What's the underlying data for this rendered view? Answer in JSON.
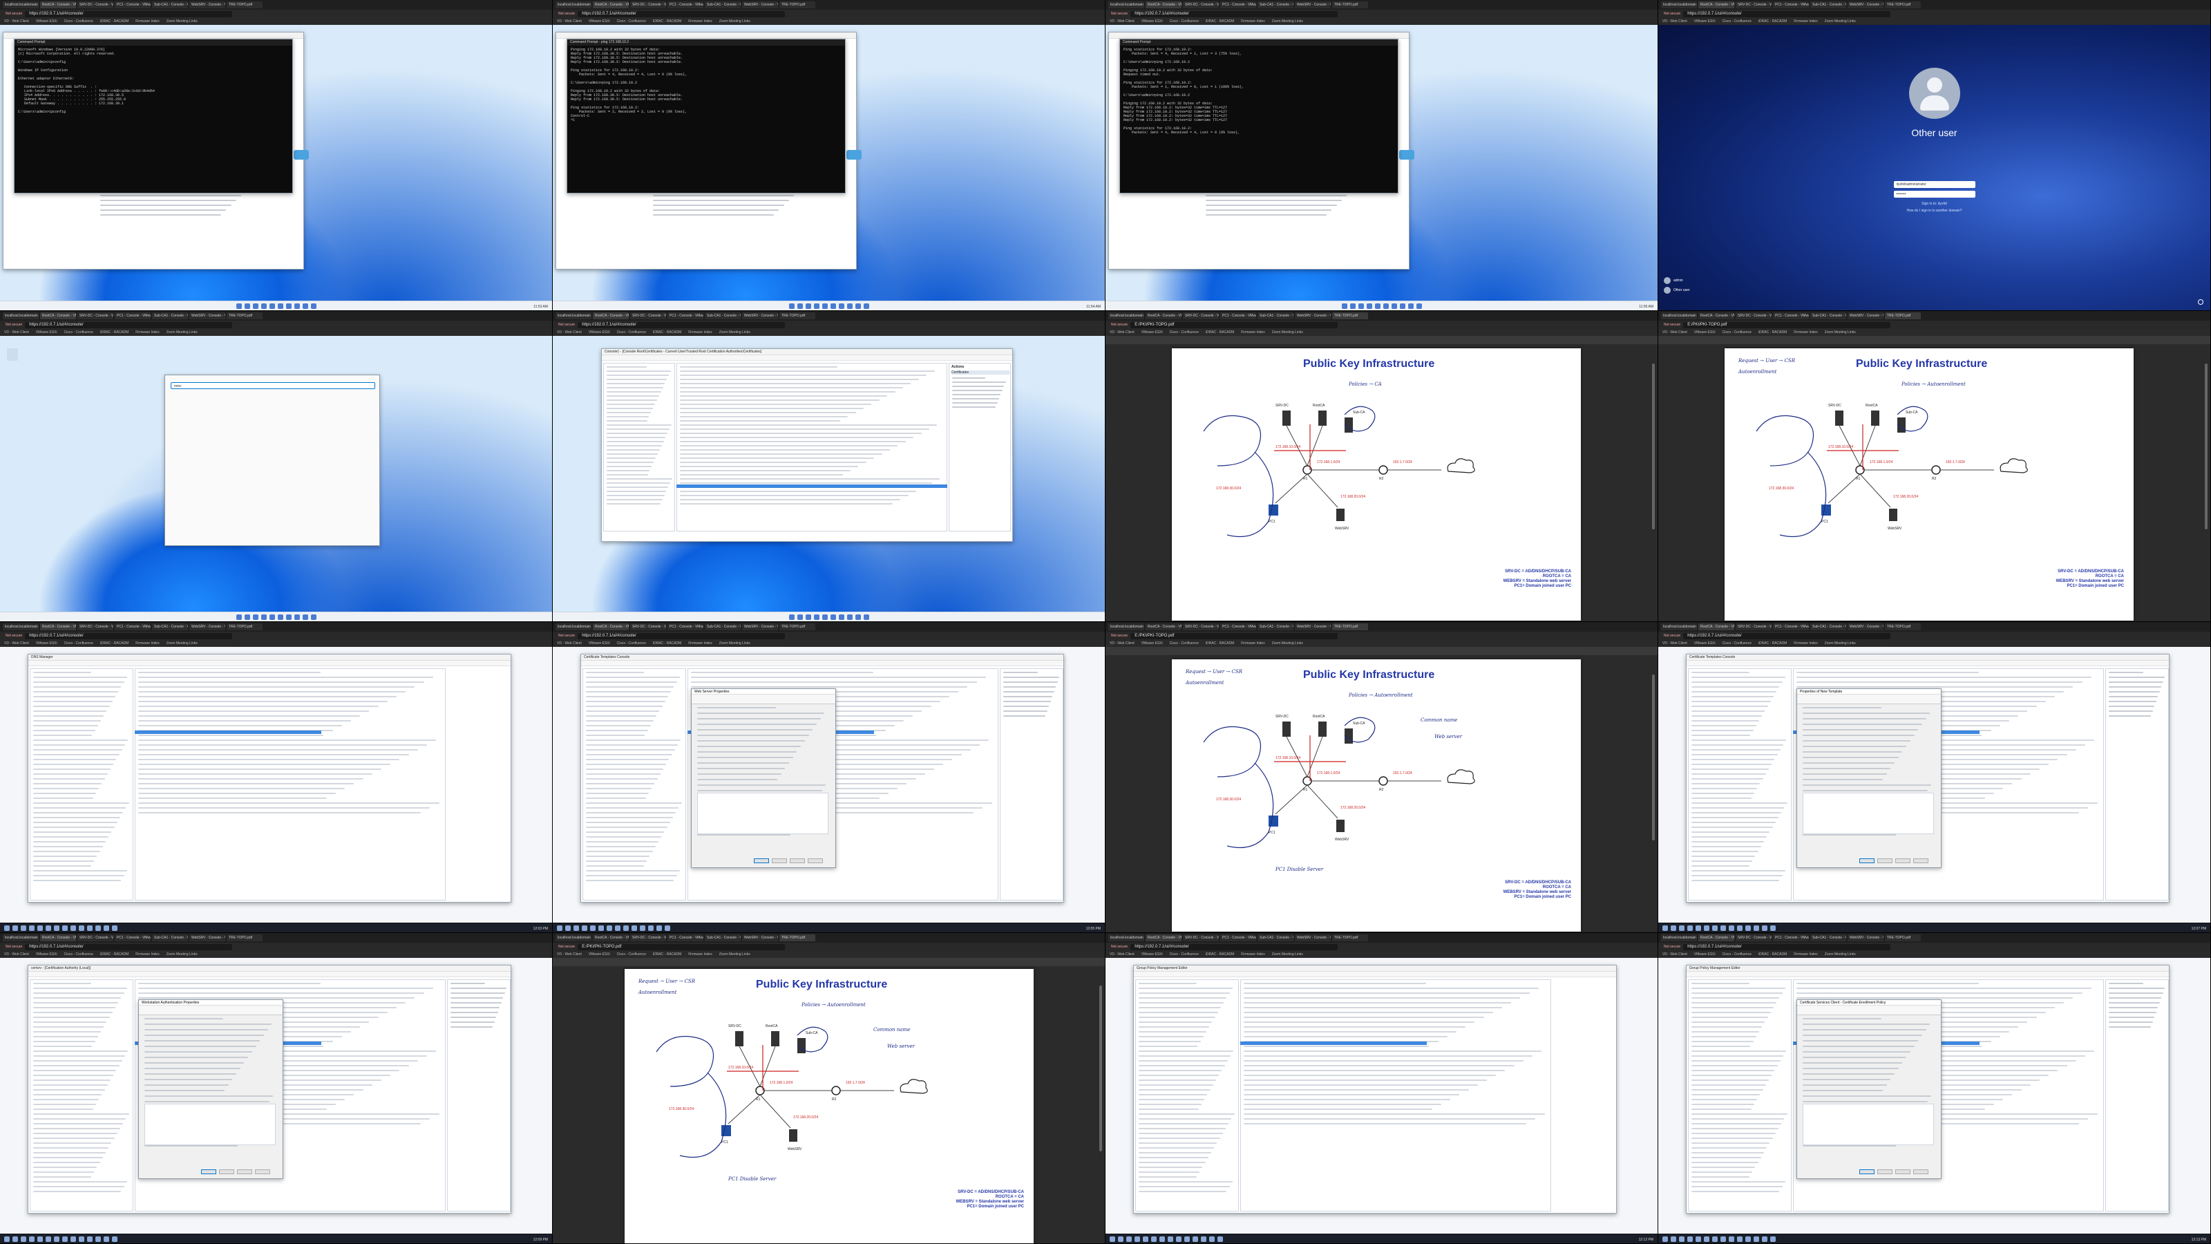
{
  "host": {
    "tab_labels": [
      "localhost.localdomain - VMware",
      "RootCA - Console - VMware ESXi",
      "SRV-DC - Console - VMware ESXi",
      "PC1 - Console - VMware ESXi",
      "Sub-CA1 - Console - VMware ESXi",
      "WebSRV - Console - VMware ESXi",
      "TRE-TOPO.pdf"
    ],
    "active_tab": "Not secure",
    "url_vmware": "https://192.0.7.1/ui/#/console/",
    "url_pdf": "E:/PKI/PKI-TOPO.pdf",
    "bookmarks": [
      "VD - Web Client",
      "VMware ESXi",
      "Cisco - Confluence",
      "iDRAC - RACADM",
      "Firmware Index",
      "Zoom Meeting Links"
    ]
  },
  "tiles": {
    "t1": {
      "kind": "cmd",
      "window_title": "Command Prompt",
      "console_text": "Microsoft Windows [Version 10.0.22000.376]\n(c) Microsoft Corporation. All rights reserved.\n\nC:\\Users\\admin>ipconfig\n\nWindows IP Configuration\n\nEthernet adapter Ethernet0:\n\n   Connection-specific DNS Suffix  . :\n   Link-local IPv6 Address . . . . . : fe80::c4d8:a28e:2c6d:9b4d%4\n   IPv4 Address. . . . . . . . . . . : 172.168.30.5\n   Subnet Mask . . . . . . . . . . . : 255.255.255.0\n   Default Gateway . . . . . . . . . : 172.168.30.1\n\nC:\\Users\\admin>ipconfig",
      "clock": "11:53 AM"
    },
    "t2": {
      "kind": "cmd",
      "window_title": "Command Prompt - ping  172.168.10.2",
      "console_text": "Pinging 172.168.10.2 with 32 bytes of data:\nReply from 172.168.30.5: Destination host unreachable.\nReply from 172.168.30.5: Destination host unreachable.\nReply from 172.168.30.5: Destination host unreachable.\n\nPing statistics for 172.168.10.2:\n    Packets: Sent = 4, Received = 4, Lost = 0 (0% loss),\n\nC:\\Users\\admin>ping 172.168.10.2\n\nPinging 172.168.10.2 with 32 bytes of data:\nReply from 172.168.30.5: Destination host unreachable.\nReply from 172.168.30.5: Destination host unreachable.\n\nPing statistics for 172.168.10.2:\n    Packets: Sent = 2, Received = 2, Lost = 0 (0% loss),\nControl-C\n^C",
      "clock": "11:54 AM"
    },
    "t3": {
      "kind": "cmd",
      "window_title": "Command Prompt",
      "console_text": "Ping statistics for 172.168.10.2:\n    Packets: Sent = 4, Received = 1, Lost = 3 (75% loss),\n\nC:\\Users\\admin>ping 172.168.10.2\n\nPinging 172.168.10.2 with 32 bytes of data:\nRequest timed out.\n\nPing statistics for 172.168.10.2:\n    Packets: Sent = 1, Received = 0, Lost = 1 (100% loss),\n\nC:\\Users\\admin>ping 172.168.10.2\n\nPinging 172.168.10.2 with 32 bytes of data:\nReply from 172.168.10.2: bytes=32 time=1ms TTL=127\nReply from 172.168.10.2: bytes=32 time<1ms TTL=127\nReply from 172.168.10.2: bytes=32 time<1ms TTL=127\nReply from 172.168.10.2: bytes=32 time<1ms TTL=127\n\nPing statistics for 172.168.10.2:\n    Packets: Sent = 4, Received = 4, Lost = 0 (0% loss),",
      "clock": "11:55 AM"
    },
    "t4": {
      "kind": "lock",
      "user_name": "Other user",
      "username_value": "ityoltd\\administrator",
      "password_value": "••••••••",
      "link_domain": "Sign in to: ityoltd",
      "link_other": "How do I sign in to another domain?",
      "accounts": [
        "admin",
        "Other user"
      ]
    },
    "t5": {
      "kind": "run",
      "run_value": "mmc"
    },
    "t6": {
      "kind": "mmc",
      "window_title": "Console1 - [Console Root\\Certificates - Current User\\Trusted Root Certification Authorities\\Certificates]",
      "actions_title": "Actions",
      "actions_item": "Certificates"
    },
    "t7": {
      "kind": "board",
      "stage": 1
    },
    "t8": {
      "kind": "board",
      "stage": 2
    },
    "t9": {
      "kind": "dns",
      "window_title": "DNS Manager",
      "clock": "12:03 PM"
    },
    "t10": {
      "kind": "ca",
      "window_title": "Certificate Templates Console",
      "dialog_title": "Web Server Properties",
      "clock": "12:05 PM"
    },
    "t11": {
      "kind": "board",
      "stage": 3
    },
    "t12": {
      "kind": "ca",
      "window_title": "Certificate Templates Console",
      "dialog_title": "Properties of New Template",
      "clock": "12:07 PM"
    },
    "t13": {
      "kind": "ca",
      "window_title": "certsrv - [Certification Authority (Local)]",
      "dialog_title": "Workstation Authentication Properties",
      "clock": "12:09 PM"
    },
    "t14": {
      "kind": "board",
      "stage": 4
    },
    "t15": {
      "kind": "gpo",
      "window_title": "Group Policy Management Editor",
      "clock": "12:12 PM"
    },
    "t16": {
      "kind": "gpo",
      "window_title": "Group Policy Management Editor",
      "dialog_title": "Certificate Services Client - Certificate Enrollment Policy",
      "clock": "12:13 PM"
    }
  },
  "board": {
    "title": "Public Key Infrastructure",
    "handwritten_top": "Policies → CA",
    "handwritten_top2": "Policies → Autoenrollment",
    "handwritten_left": "Request → User → CSR",
    "handwritten_left2": "Autoenrollment",
    "handwritten_right": "Common name",
    "handwritten_right2": "Web server",
    "handwritten_bottom": "PC1 Disable Server",
    "node_labels": [
      "SRV-DC",
      "RootCA",
      "Sub-CA",
      "WebSRV",
      "PC1",
      "R1",
      "R2"
    ],
    "subnets": [
      "172.168.10.0/24",
      "172.168.1.0/24",
      "172.168.30.0/24",
      "172.168.20.0/24",
      "192.1.7.0/24"
    ],
    "notes": "SRV-DC = AD/DNS/DHCP/SUB-CA\nROOTCA = CA\nWEBSRV = Standalone web server\nPC1= Domain joined user PC"
  }
}
